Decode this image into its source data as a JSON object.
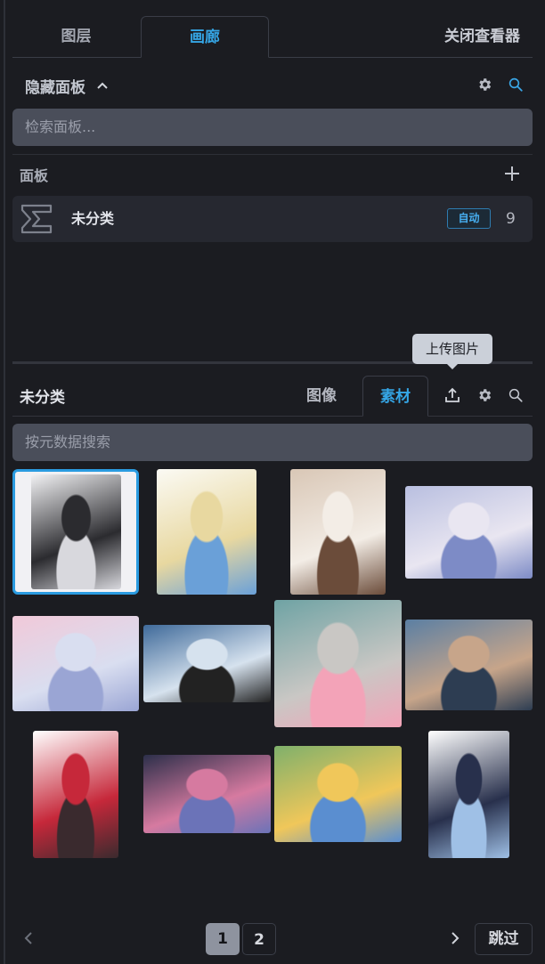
{
  "tabs": {
    "layers": "图层",
    "gallery": "画廊",
    "close_viewer": "关闭查看器"
  },
  "boards_panel": {
    "toggle_label": "隐藏面板",
    "search_placeholder": "检索面板...",
    "section_label": "面板",
    "boards": [
      {
        "name": "未分类",
        "badge": "自动",
        "count": "9"
      }
    ]
  },
  "gallery": {
    "title": "未分类",
    "tab_images": "图像",
    "tab_assets": "素材",
    "upload_tooltip": "上传图片",
    "search_placeholder": "按元数据搜索",
    "thumbnails": [
      {
        "name": "thumb-1",
        "selected": true,
        "palette": [
          "#f2f2f4",
          "#2b2b2f",
          "#d8d8dd"
        ]
      },
      {
        "name": "thumb-2",
        "palette": [
          "#fbfaf4",
          "#e8d8a0",
          "#6aa0d8"
        ]
      },
      {
        "name": "thumb-3",
        "palette": [
          "#d9c7b6",
          "#f3ede6",
          "#6b4c3a"
        ]
      },
      {
        "name": "thumb-4",
        "palette": [
          "#b9bfe0",
          "#e9e6f1",
          "#7d8bc6"
        ]
      },
      {
        "name": "thumb-5",
        "palette": [
          "#f1c9d9",
          "#d9def0",
          "#9aa5d4"
        ]
      },
      {
        "name": "thumb-6",
        "palette": [
          "#3f6a9a",
          "#d6e2ee",
          "#222"
        ]
      },
      {
        "name": "thumb-7",
        "palette": [
          "#6fa3a4",
          "#c9c7c4",
          "#f3a3b8"
        ]
      },
      {
        "name": "thumb-8",
        "palette": [
          "#5b7fa3",
          "#c7a58a",
          "#2d3d52"
        ]
      },
      {
        "name": "thumb-9",
        "palette": [
          "#ffffff",
          "#c6283a",
          "#3a2a2e"
        ]
      },
      {
        "name": "thumb-10",
        "palette": [
          "#2c2f4a",
          "#d67aa0",
          "#6b73b8"
        ]
      },
      {
        "name": "thumb-11",
        "palette": [
          "#7fb06b",
          "#f0c75a",
          "#5a8ed0"
        ]
      },
      {
        "name": "thumb-12",
        "palette": [
          "#ffffff",
          "#28304c",
          "#9fc0e6"
        ]
      }
    ]
  },
  "pagination": {
    "pages": [
      "1",
      "2"
    ],
    "current": "1",
    "skip_label": "跳过"
  },
  "colors": {
    "accent": "#35a6e6",
    "background": "#1b1c21",
    "input": "#4a4e5a"
  }
}
